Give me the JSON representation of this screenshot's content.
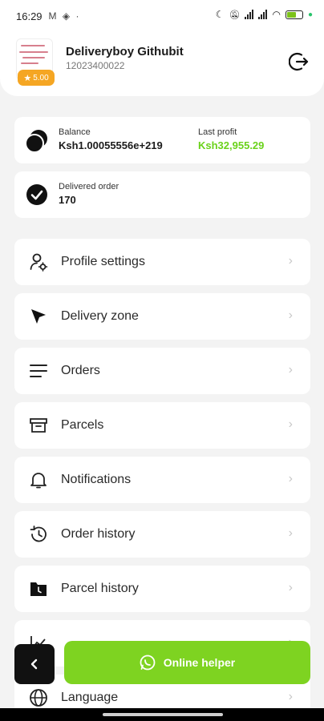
{
  "status_bar": {
    "time": "16:29",
    "left_icons": "M ◈ ·"
  },
  "header": {
    "user_name": "Deliveryboy Githubit",
    "user_phone": "12023400022",
    "rating": "5.00"
  },
  "balance_card": {
    "balance_label": "Balance",
    "balance_value": "Ksh1.00055556e+219",
    "profit_label": "Last profit",
    "profit_value": "Ksh32,955.29"
  },
  "delivered_card": {
    "label": "Delivered order",
    "value": "170"
  },
  "menu": [
    {
      "label": "Profile settings",
      "icon": "user-gear-icon"
    },
    {
      "label": "Delivery zone",
      "icon": "navigation-arrow-icon"
    },
    {
      "label": "Orders",
      "icon": "list-icon"
    },
    {
      "label": "Parcels",
      "icon": "archive-box-icon"
    },
    {
      "label": "Notifications",
      "icon": "bell-icon"
    },
    {
      "label": "Order history",
      "icon": "history-icon"
    },
    {
      "label": "Parcel history",
      "icon": "folder-icon"
    },
    {
      "label": "Language",
      "icon": "globe-icon"
    }
  ],
  "online_helper": {
    "label": "Online helper"
  },
  "colors": {
    "accent_green": "#7ed321",
    "profit_green": "#6ad21a",
    "rating_orange": "#f5a623"
  }
}
